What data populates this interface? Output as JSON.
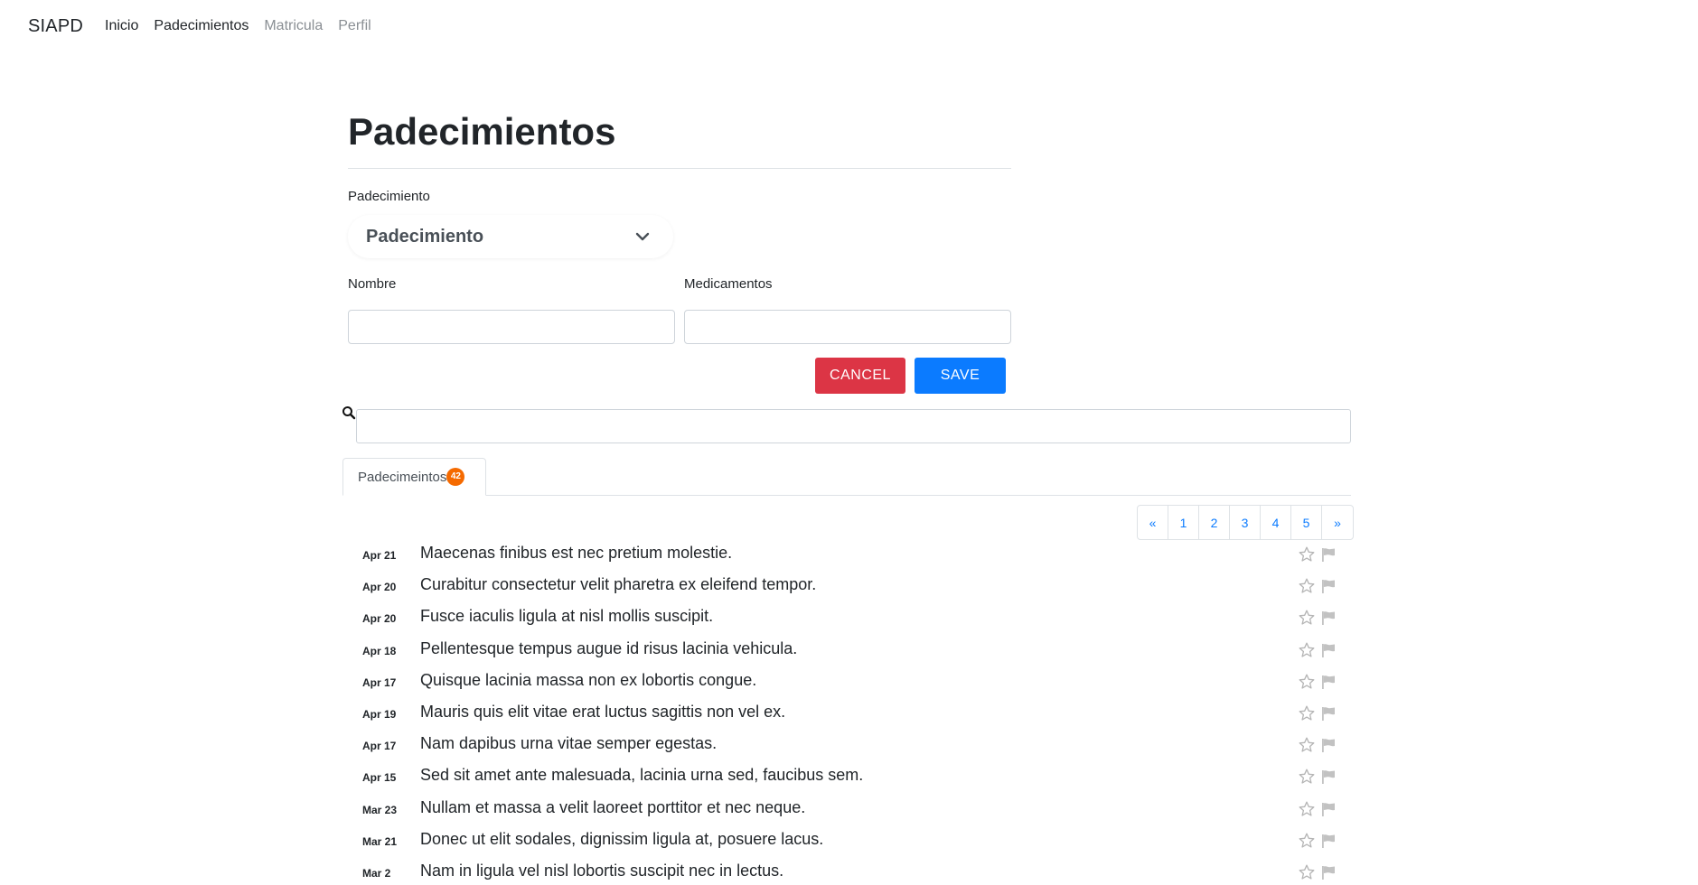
{
  "navbar": {
    "brand": "SIAPD",
    "links": [
      "Inicio",
      "Padecimientos",
      "Matricula",
      "Perfil"
    ]
  },
  "page_title": "Padecimientos",
  "form": {
    "padecimiento_label": "Padecimiento",
    "select_value": "Padecimiento",
    "nombre_label": "Nombre",
    "medicamentos_label": "Medicamentos",
    "nombre_value": "",
    "medicamentos_value": "",
    "cancel_label": "CANCEL",
    "save_label": "SAVE"
  },
  "search": {
    "value": ""
  },
  "tabs": [
    {
      "label": "Padecimeintos",
      "count": "42"
    }
  ],
  "pagination": [
    "«",
    "1",
    "2",
    "3",
    "4",
    "5",
    "»"
  ],
  "items": [
    {
      "date": "Apr 21",
      "text": "Maecenas finibus est nec pretium molestie."
    },
    {
      "date": "Apr 20",
      "text": "Curabitur consectetur velit pharetra ex eleifend tempor."
    },
    {
      "date": "Apr 20",
      "text": "Fusce iaculis ligula at nisl mollis suscipit."
    },
    {
      "date": "Apr 18",
      "text": "Pellentesque tempus augue id risus lacinia vehicula."
    },
    {
      "date": "Apr 17",
      "text": "Quisque lacinia massa non ex lobortis congue."
    },
    {
      "date": "Apr 19",
      "text": "Mauris quis elit vitae erat luctus sagittis non vel ex."
    },
    {
      "date": "Apr 17",
      "text": "Nam dapibus urna vitae semper egestas."
    },
    {
      "date": "Apr 15",
      "text": "Sed sit amet ante malesuada, lacinia urna sed, faucibus sem."
    },
    {
      "date": "Mar 23",
      "text": "Nullam et massa a velit laoreet porttitor et nec neque."
    },
    {
      "date": "Mar 21",
      "text": "Donec ut elit sodales, dignissim ligula at, posuere lacus."
    },
    {
      "date": "Mar 2",
      "text": "Nam in ligula vel nisl lobortis suscipit nec in lectus."
    }
  ],
  "colors": {
    "cancel": "#dc3545",
    "save": "#0b7bff",
    "badge": "#f56a00",
    "link": "#0b7bff"
  }
}
